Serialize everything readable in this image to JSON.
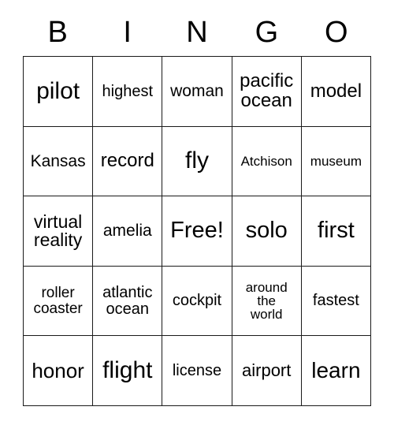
{
  "header": {
    "letters": [
      "B",
      "I",
      "N",
      "G",
      "O"
    ]
  },
  "grid": {
    "rows": 5,
    "columns": 5,
    "free_space": {
      "row": 2,
      "column": 2,
      "label": "Free!"
    },
    "cells": [
      {
        "text": "pilot",
        "size": "fs-30"
      },
      {
        "text": "highest",
        "size": "fs-20"
      },
      {
        "text": "woman",
        "size": "fs-21"
      },
      {
        "text": "pacific\nocean",
        "size": "fs-24"
      },
      {
        "text": "model",
        "size": "fs-24"
      },
      {
        "text": "Kansas",
        "size": "fs-21"
      },
      {
        "text": "record",
        "size": "fs-24"
      },
      {
        "text": "fly",
        "size": "fs-30"
      },
      {
        "text": "Atchison",
        "size": "fs-17"
      },
      {
        "text": "museum",
        "size": "fs-17"
      },
      {
        "text": "virtual\nreality",
        "size": "fs-23"
      },
      {
        "text": "amelia",
        "size": "fs-21"
      },
      {
        "text": "Free!",
        "size": "fs-29"
      },
      {
        "text": "solo",
        "size": "fs-29"
      },
      {
        "text": "first",
        "size": "fs-29"
      },
      {
        "text": "roller\ncoaster",
        "size": "fs-19"
      },
      {
        "text": "atlantic\nocean",
        "size": "fs-20"
      },
      {
        "text": "cockpit",
        "size": "fs-20"
      },
      {
        "text": "around\nthe\nworld",
        "size": "fs-17"
      },
      {
        "text": "fastest",
        "size": "fs-20"
      },
      {
        "text": "honor",
        "size": "fs-26"
      },
      {
        "text": "flight",
        "size": "fs-30"
      },
      {
        "text": "license",
        "size": "fs-20"
      },
      {
        "text": "airport",
        "size": "fs-22"
      },
      {
        "text": "learn",
        "size": "fs-28"
      }
    ]
  },
  "colors": {
    "background": "#ffffff",
    "border": "#1a1a1a",
    "text": "#000000"
  }
}
